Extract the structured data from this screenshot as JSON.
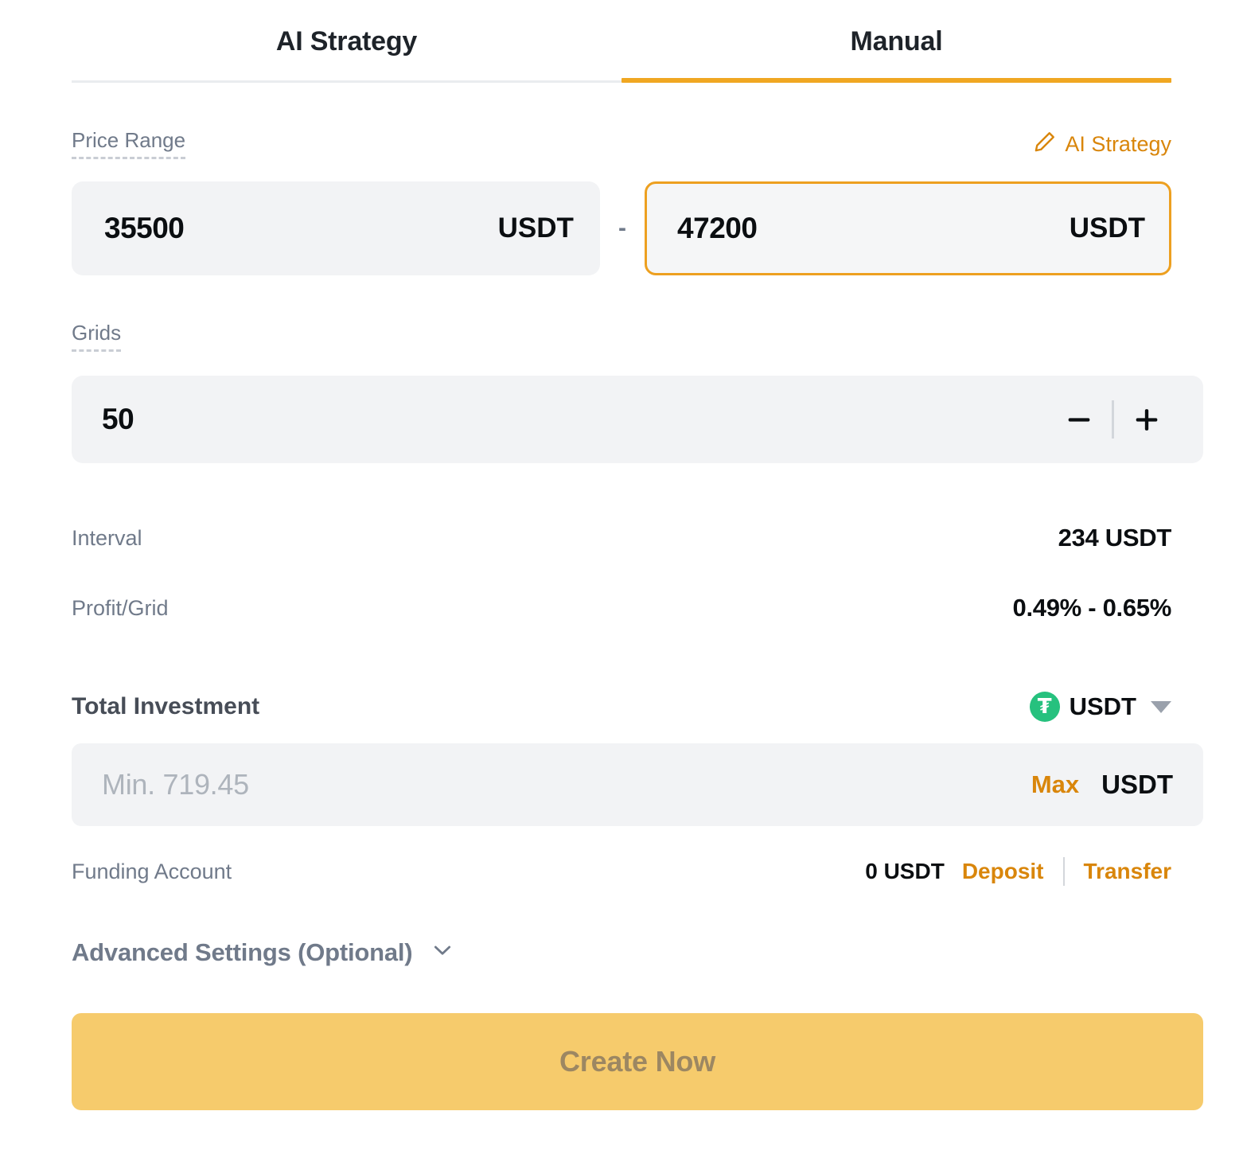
{
  "tabs": [
    {
      "label": "AI Strategy",
      "active": false
    },
    {
      "label": "Manual",
      "active": true
    }
  ],
  "price_range": {
    "label": "Price Range",
    "ai_strategy_link": "AI Strategy",
    "separator": "-",
    "lower": {
      "value": "35500",
      "unit": "USDT"
    },
    "upper": {
      "value": "47200",
      "unit": "USDT"
    }
  },
  "grids": {
    "label": "Grids",
    "value": "50",
    "decrement": "−",
    "increment": "+"
  },
  "info": [
    {
      "key": "Interval",
      "value": "234 USDT"
    },
    {
      "key": "Profit/Grid",
      "value": "0.49% - 0.65%"
    }
  ],
  "total_investment": {
    "title": "Total Investment",
    "coin_symbol": "₮",
    "coin_name": "USDT",
    "placeholder": "Min. 719.45",
    "max_label": "Max",
    "unit": "USDT"
  },
  "funding_account": {
    "label": "Funding Account",
    "balance": "0 USDT",
    "deposit_label": "Deposit",
    "transfer_label": "Transfer"
  },
  "advanced_settings": {
    "label": "Advanced Settings (Optional)"
  },
  "create_button": {
    "label": "Create Now"
  },
  "colors": {
    "accent_orange": "#F0A722",
    "link_orange": "#D9860B",
    "button_bg": "#F6CB6C",
    "button_text": "#9C8762",
    "input_bg": "#F2F3F5",
    "muted_text": "#707A8A",
    "primary_text": "#0B0E11",
    "usdt_green": "#26C17E"
  }
}
